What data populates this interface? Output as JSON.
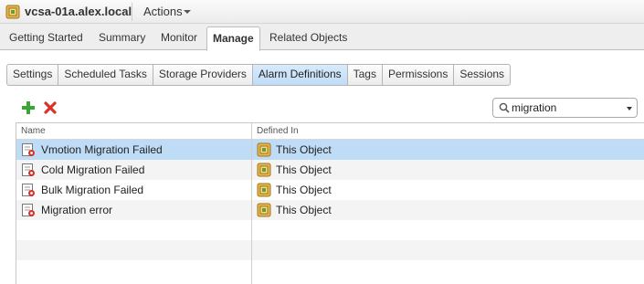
{
  "header": {
    "title": "vcsa-01a.alex.local",
    "actions_label": "Actions",
    "title_icon": "vcenter-server-icon"
  },
  "main_tabs": [
    {
      "label": "Getting Started",
      "active": false
    },
    {
      "label": "Summary",
      "active": false
    },
    {
      "label": "Monitor",
      "active": false
    },
    {
      "label": "Manage",
      "active": true
    },
    {
      "label": "Related Objects",
      "active": false
    }
  ],
  "subtabs": [
    {
      "label": "Settings",
      "active": false
    },
    {
      "label": "Scheduled Tasks",
      "active": false
    },
    {
      "label": "Storage Providers",
      "active": false
    },
    {
      "label": "Alarm Definitions",
      "active": true
    },
    {
      "label": "Tags",
      "active": false
    },
    {
      "label": "Permissions",
      "active": false
    },
    {
      "label": "Sessions",
      "active": false
    }
  ],
  "toolbar": {
    "add_icon": "plus-icon",
    "delete_icon": "delete-x-icon"
  },
  "search": {
    "value": "migration"
  },
  "table": {
    "columns": [
      "Name",
      "Defined In"
    ],
    "rows": [
      {
        "name": "Vmotion Migration Failed",
        "defined_in": "This Object",
        "selected": true
      },
      {
        "name": "Cold Migration Failed",
        "defined_in": "This Object",
        "selected": false
      },
      {
        "name": "Bulk Migration Failed",
        "defined_in": "This Object",
        "selected": false
      },
      {
        "name": "Migration error",
        "defined_in": "This Object",
        "selected": false
      }
    ]
  },
  "colors": {
    "selection": "#bfdcf7",
    "active_subtab": "#c9e2f9",
    "add_green": "#3aa635",
    "delete_red": "#d9322b"
  }
}
